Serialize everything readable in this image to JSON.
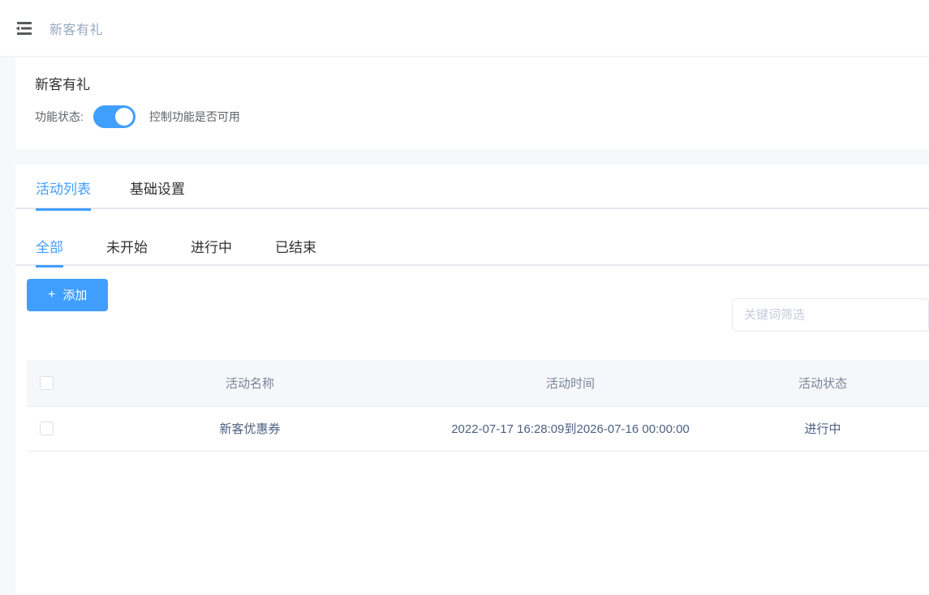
{
  "navbar": {
    "menu_icon": "menu-fold-icon",
    "title": "新客有礼"
  },
  "status_card": {
    "title": "新客有礼",
    "switch_label": "功能状态:",
    "switch_state": "on",
    "hint": "控制功能是否可用"
  },
  "tabs": [
    {
      "label": "活动列表",
      "active": true
    },
    {
      "label": "基础设置",
      "active": false
    }
  ],
  "subtabs": [
    {
      "label": "全部",
      "active": true
    },
    {
      "label": "未开始",
      "active": false
    },
    {
      "label": "进行中",
      "active": false
    },
    {
      "label": "已结束",
      "active": false
    }
  ],
  "toolbar": {
    "add_label": "添加",
    "add_icon": "plus-icon",
    "search_placeholder": "关键词筛选",
    "search_value": ""
  },
  "table": {
    "columns": [
      "活动名称",
      "活动时间",
      "活动状态"
    ],
    "rows": [
      {
        "name": "新客优惠券",
        "time": "2022-07-17 16:28:09到2026-07-16 00:00:00",
        "status": "进行中"
      }
    ]
  },
  "colors": {
    "primary": "#409eff",
    "page_bg": "#f7f8fa",
    "table_head_bg": "#f5f7fa",
    "text": "#303133",
    "muted": "#97a8be"
  }
}
